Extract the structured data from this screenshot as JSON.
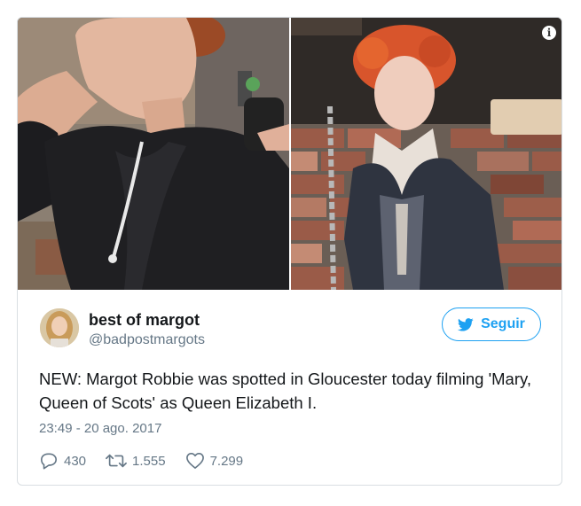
{
  "tweet": {
    "author_name": "best of margot",
    "author_handle": "@badpostmargots",
    "follow_label": "Seguir",
    "text": "NEW: Margot Robbie was spotted in Gloucester today filming 'Mary, Queen of Scots' as Queen Elizabeth I.",
    "timestamp": "23:49 - 20 ago. 2017",
    "replies": "430",
    "retweets": "1.555",
    "likes": "7.299"
  },
  "icons": {
    "info": "info-icon",
    "bird": "twitter-bird-icon",
    "reply": "reply-icon",
    "retweet": "retweet-icon",
    "like": "heart-icon"
  },
  "colors": {
    "accent": "#1da1f2",
    "text": "#14171a",
    "secondary": "#657786",
    "border": "#d9dee2"
  }
}
